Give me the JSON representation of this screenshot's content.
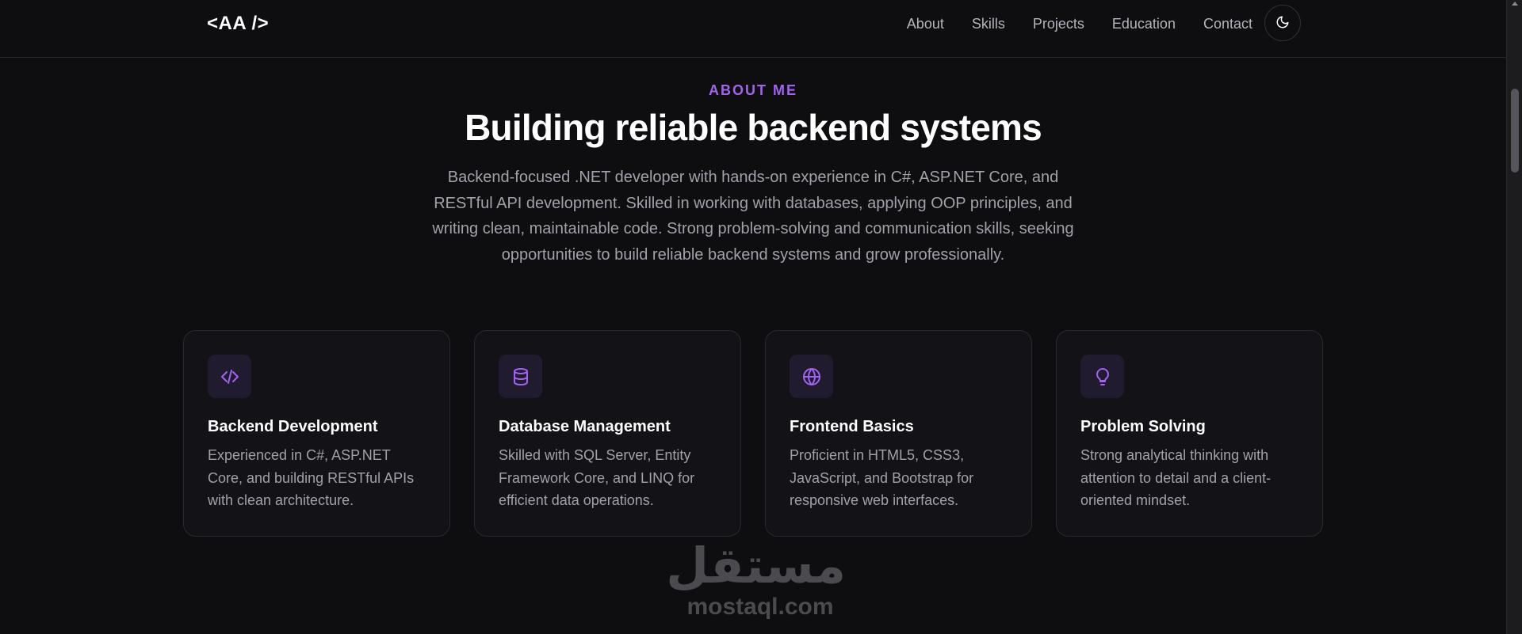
{
  "header": {
    "logo": "<AA />",
    "nav": [
      "About",
      "Skills",
      "Projects",
      "Education",
      "Contact"
    ],
    "theme_toggle_icon": "moon-icon"
  },
  "about": {
    "eyebrow": "ABOUT ME",
    "title": "Building reliable backend systems",
    "description": "Backend-focused .NET developer with hands-on experience in C#, ASP.NET Core, and RESTful API development. Skilled in working with databases, applying OOP principles, and writing clean, maintainable code. Strong problem-solving and communication skills, seeking opportunities to build reliable backend systems and grow professionally."
  },
  "cards": [
    {
      "icon": "code-icon",
      "title": "Backend Development",
      "description": "Experienced in C#, ASP.NET Core, and building RESTful APIs with clean architecture."
    },
    {
      "icon": "database-icon",
      "title": "Database Management",
      "description": "Skilled with SQL Server, Entity Framework Core, and LINQ for efficient data operations."
    },
    {
      "icon": "globe-icon",
      "title": "Frontend Basics",
      "description": "Proficient in HTML5, CSS3, JavaScript, and Bootstrap for responsive web interfaces."
    },
    {
      "icon": "lightbulb-icon",
      "title": "Problem Solving",
      "description": "Strong analytical thinking with attention to detail and a client-oriented mindset."
    }
  ],
  "watermark": {
    "arabic": "مستقل",
    "latin": "mostaql.com"
  },
  "colors": {
    "background": "#0e0e11",
    "accent": "#a263f0",
    "card_background": "#131217",
    "muted_text": "#a1a1aa"
  }
}
